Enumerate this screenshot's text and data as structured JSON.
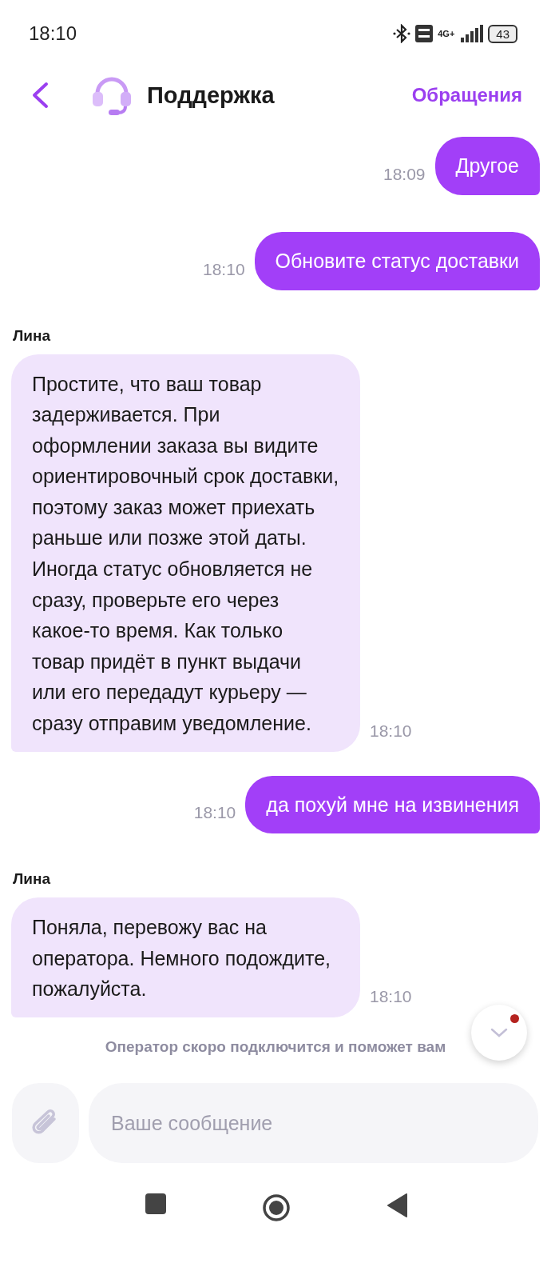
{
  "status_bar": {
    "time": "18:10",
    "battery": "43",
    "network": "4G+"
  },
  "header": {
    "title": "Поддержка",
    "action": "Обращения"
  },
  "messages": [
    {
      "kind": "outgoing",
      "text": "Другое",
      "time": "18:09"
    },
    {
      "kind": "outgoing",
      "text": "Обновите статус доставки",
      "time": "18:10"
    },
    {
      "kind": "incoming",
      "sender": "Лина",
      "text": "Простите, что ваш товар задерживается. При оформлении заказа вы видите ориентировочный срок доставки, поэтому заказ может приехать раньше или позже этой даты. Иногда статус обновляется не сразу, проверьте его через какое-то время. Как только товар придёт в пункт выдачи или его передадут курьеру — сразу отправим уведомление.",
      "time": "18:10"
    },
    {
      "kind": "outgoing",
      "text": "да похуй мне на извинения",
      "time": "18:10"
    },
    {
      "kind": "incoming",
      "sender": "Лина",
      "text": "Поняла, перевожу вас на оператора. Немного подождите, пожалуйста.",
      "time": "18:10"
    },
    {
      "kind": "notice",
      "text": "Оператор скоро подключится и поможет вам"
    }
  ],
  "scroll_button": {
    "unread": true
  },
  "composer": {
    "placeholder": "Ваше сообщение"
  }
}
